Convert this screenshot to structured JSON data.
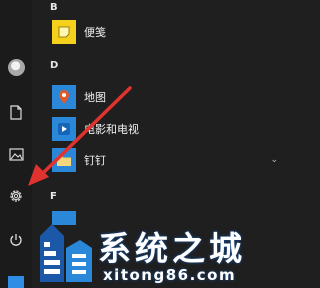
{
  "start_menu": {
    "groups": [
      {
        "letter": "B",
        "apps": [
          {
            "name": "便笺",
            "icon": "sticky-notes-icon"
          }
        ]
      },
      {
        "letter": "D",
        "apps": [
          {
            "name": "地图",
            "icon": "maps-icon"
          },
          {
            "name": "电影和电视",
            "icon": "movies-tv-icon"
          },
          {
            "name": "钉钉",
            "icon": "dingtalk-folder-icon",
            "expandable": true
          }
        ]
      },
      {
        "letter": "F",
        "apps": []
      }
    ]
  },
  "sidebar": {
    "items": [
      "user-avatar",
      "documents-icon",
      "pictures-icon",
      "settings-icon",
      "power-icon"
    ]
  },
  "watermark": {
    "title": "系统之城",
    "url": "xitong86.com"
  },
  "colors": {
    "background": "#1f1f1f",
    "accent_blue": "#2b88d8",
    "arrow_red": "#e0322f",
    "sticky_yellow": "#f6d11b",
    "maps_orange": "#e05a2b",
    "folder_yellow": "#f0c75e"
  }
}
